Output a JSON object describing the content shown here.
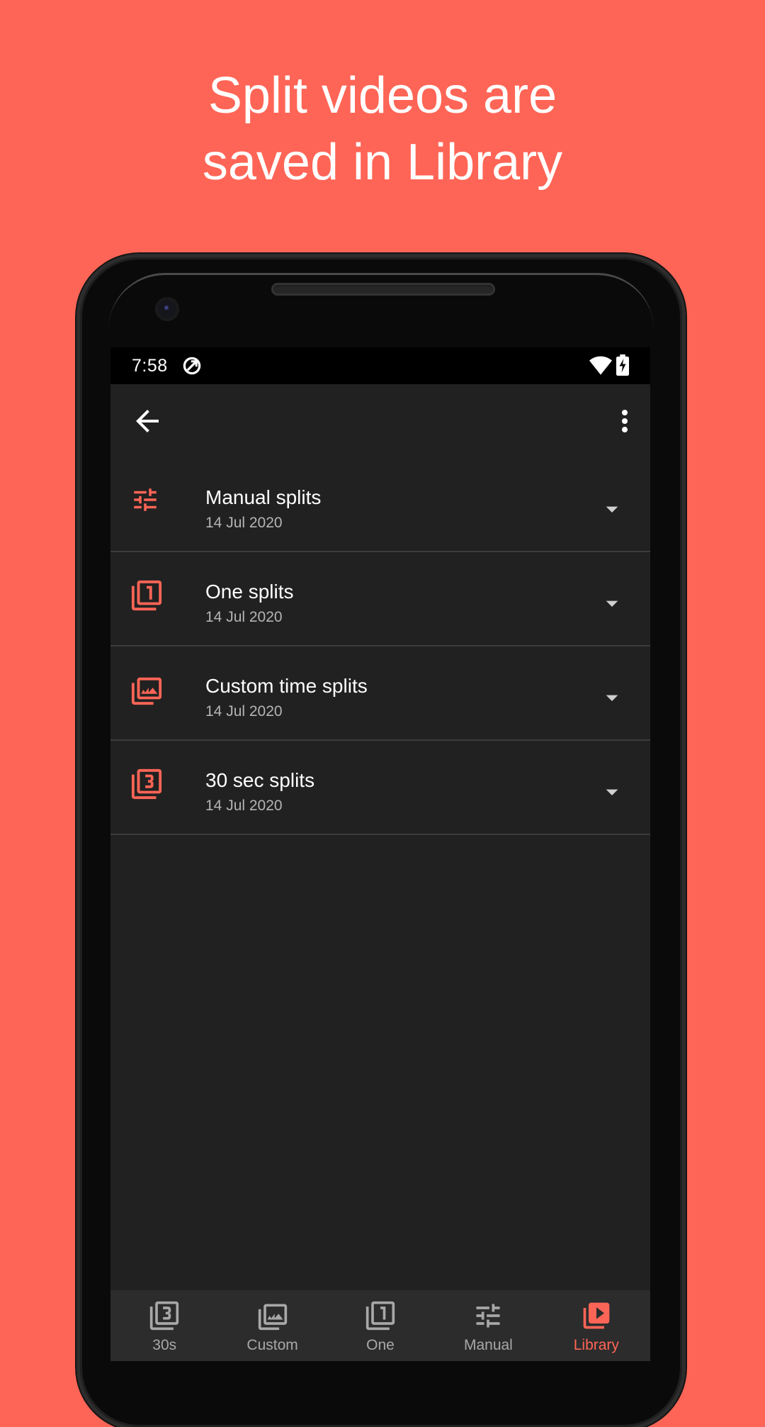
{
  "headline": {
    "line1": "Split videos are",
    "line2": "saved in Library"
  },
  "status_bar": {
    "time": "7:58",
    "icons": [
      "sync-icon",
      "wifi-icon",
      "battery-charging-icon"
    ]
  },
  "toolbar": {
    "back_icon": "arrow-back-icon",
    "menu_icon": "more-vert-icon"
  },
  "library_items": [
    {
      "title": "Manual splits",
      "date": "14 Jul 2020",
      "icon": "tune-icon",
      "expand_icon": "arrow-drop-down-icon"
    },
    {
      "title": "One splits",
      "date": "14 Jul 2020",
      "icon": "filter-1-icon",
      "expand_icon": "arrow-drop-down-icon"
    },
    {
      "title": "Custom time splits",
      "date": "14 Jul 2020",
      "icon": "photo-library-icon",
      "expand_icon": "arrow-drop-down-icon"
    },
    {
      "title": "30 sec splits",
      "date": "14 Jul 2020",
      "icon": "filter-3-icon",
      "expand_icon": "arrow-drop-down-icon"
    }
  ],
  "bottom_nav": [
    {
      "label": "30s",
      "icon": "filter-3-icon",
      "active": false
    },
    {
      "label": "Custom",
      "icon": "photo-library-icon",
      "active": false
    },
    {
      "label": "One",
      "icon": "filter-1-icon",
      "active": false
    },
    {
      "label": "Manual",
      "icon": "tune-icon",
      "active": false
    },
    {
      "label": "Library",
      "icon": "video-library-icon",
      "active": true
    }
  ],
  "colors": {
    "background": "#FF6556",
    "accent": "#FF6556",
    "screen_bg": "#212121",
    "nav_bg": "#2C2C2C",
    "primary_text": "#FFFFFF",
    "secondary_text": "#B4B4B4",
    "inactive_nav": "#A8A8A8"
  }
}
